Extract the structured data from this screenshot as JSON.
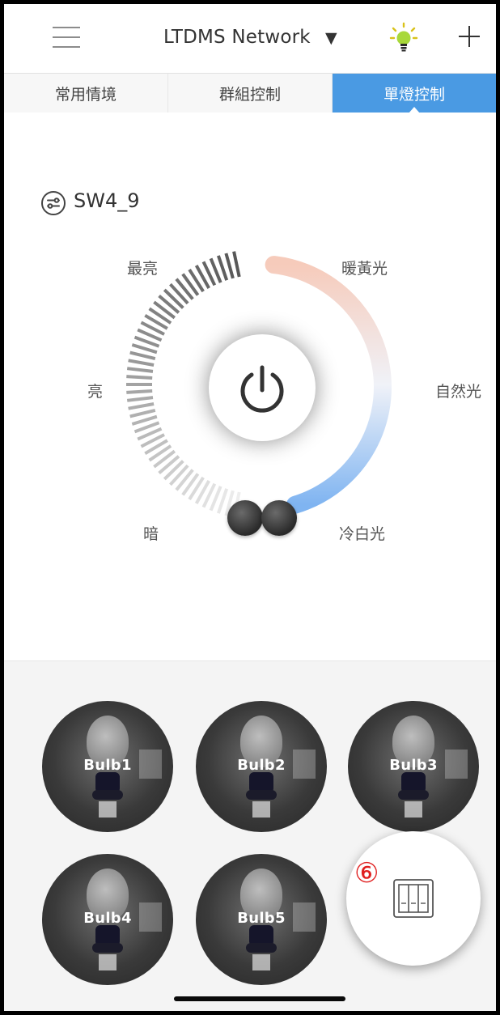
{
  "header": {
    "menu_icon": "hamburger-icon",
    "network_name": "LTDMS Network",
    "network_caret": "▼",
    "bulb_icon": "lightbulb-icon",
    "add_icon": "plus-icon"
  },
  "tabs": [
    {
      "label": "常用情境",
      "active": false
    },
    {
      "label": "群組控制",
      "active": false
    },
    {
      "label": "單燈控制",
      "active": true
    }
  ],
  "device": {
    "icon": "switch-icon",
    "name": "SW4_9"
  },
  "dial": {
    "brightness_labels": {
      "max": "最亮",
      "bright": "亮",
      "dark": "暗"
    },
    "color_labels": {
      "warm": "暖黃光",
      "natural": "自然光",
      "cool": "冷白光"
    },
    "power_icon": "power-icon"
  },
  "colors": {
    "tab_active": "#4a9ae3",
    "warm": "#f6cbbb",
    "cool": "#7fb4f1",
    "badge": "#e02020"
  },
  "bulbs": [
    {
      "label": "Bulb1"
    },
    {
      "label": "Bulb2"
    },
    {
      "label": "Bulb3"
    },
    {
      "label": "Bulb4"
    },
    {
      "label": "Bulb5"
    }
  ],
  "fab": {
    "badge": "⑥",
    "icon": "wall-switch-icon"
  }
}
